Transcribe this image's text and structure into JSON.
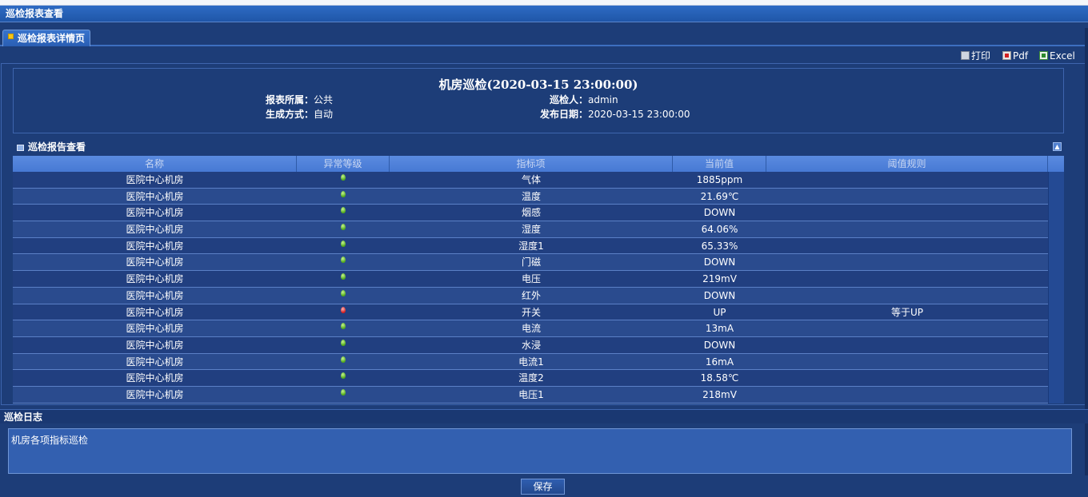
{
  "window": {
    "title": "巡检报表查看"
  },
  "tabs": [
    {
      "label": "巡检报表详情页",
      "active": true
    }
  ],
  "toolbar": {
    "print_label": "打印",
    "pdf_label": "Pdf",
    "excel_label": "Excel"
  },
  "report": {
    "title": "机房巡检(2020-03-15 23:00:00)",
    "owner_label": "报表所属：",
    "owner_value": "公共",
    "inspector_label": "巡检人：",
    "inspector_value": "admin",
    "gen_label": "生成方式：",
    "gen_value": "自动",
    "date_label": "发布日期：",
    "date_value": "2020-03-15 23:00:00"
  },
  "panel": {
    "title": "巡检报告查看"
  },
  "table": {
    "columns": [
      "名称",
      "异常等级",
      "指标项",
      "当前值",
      "阈值规则"
    ],
    "rows": [
      {
        "name": "医院中心机房",
        "level": "ok",
        "item": "气体",
        "value": "1885ppm",
        "rule": ""
      },
      {
        "name": "医院中心机房",
        "level": "ok",
        "item": "温度",
        "value": "21.69℃",
        "rule": ""
      },
      {
        "name": "医院中心机房",
        "level": "ok",
        "item": "烟感",
        "value": "DOWN",
        "rule": ""
      },
      {
        "name": "医院中心机房",
        "level": "ok",
        "item": "湿度",
        "value": "64.06%",
        "rule": ""
      },
      {
        "name": "医院中心机房",
        "level": "ok",
        "item": "湿度1",
        "value": "65.33%",
        "rule": ""
      },
      {
        "name": "医院中心机房",
        "level": "ok",
        "item": "门磁",
        "value": "DOWN",
        "rule": ""
      },
      {
        "name": "医院中心机房",
        "level": "ok",
        "item": "电压",
        "value": "219mV",
        "rule": ""
      },
      {
        "name": "医院中心机房",
        "level": "ok",
        "item": "红外",
        "value": "DOWN",
        "rule": ""
      },
      {
        "name": "医院中心机房",
        "level": "alarm",
        "item": "开关",
        "value": "UP",
        "rule": "等于UP"
      },
      {
        "name": "医院中心机房",
        "level": "ok",
        "item": "电流",
        "value": "13mA",
        "rule": ""
      },
      {
        "name": "医院中心机房",
        "level": "ok",
        "item": "水浸",
        "value": "DOWN",
        "rule": ""
      },
      {
        "name": "医院中心机房",
        "level": "ok",
        "item": "电流1",
        "value": "16mA",
        "rule": ""
      },
      {
        "name": "医院中心机房",
        "level": "ok",
        "item": "温度2",
        "value": "18.58℃",
        "rule": ""
      },
      {
        "name": "医院中心机房",
        "level": "ok",
        "item": "电压1",
        "value": "218mV",
        "rule": ""
      }
    ]
  },
  "log": {
    "title": "巡检日志",
    "content": "机房各项指标巡检"
  },
  "actions": {
    "save_label": "保存"
  },
  "colors": {
    "ok": "#4ea81a",
    "alarm": "#d31c1c",
    "header": "#1f56a8",
    "table_header": "#5a8be0"
  }
}
